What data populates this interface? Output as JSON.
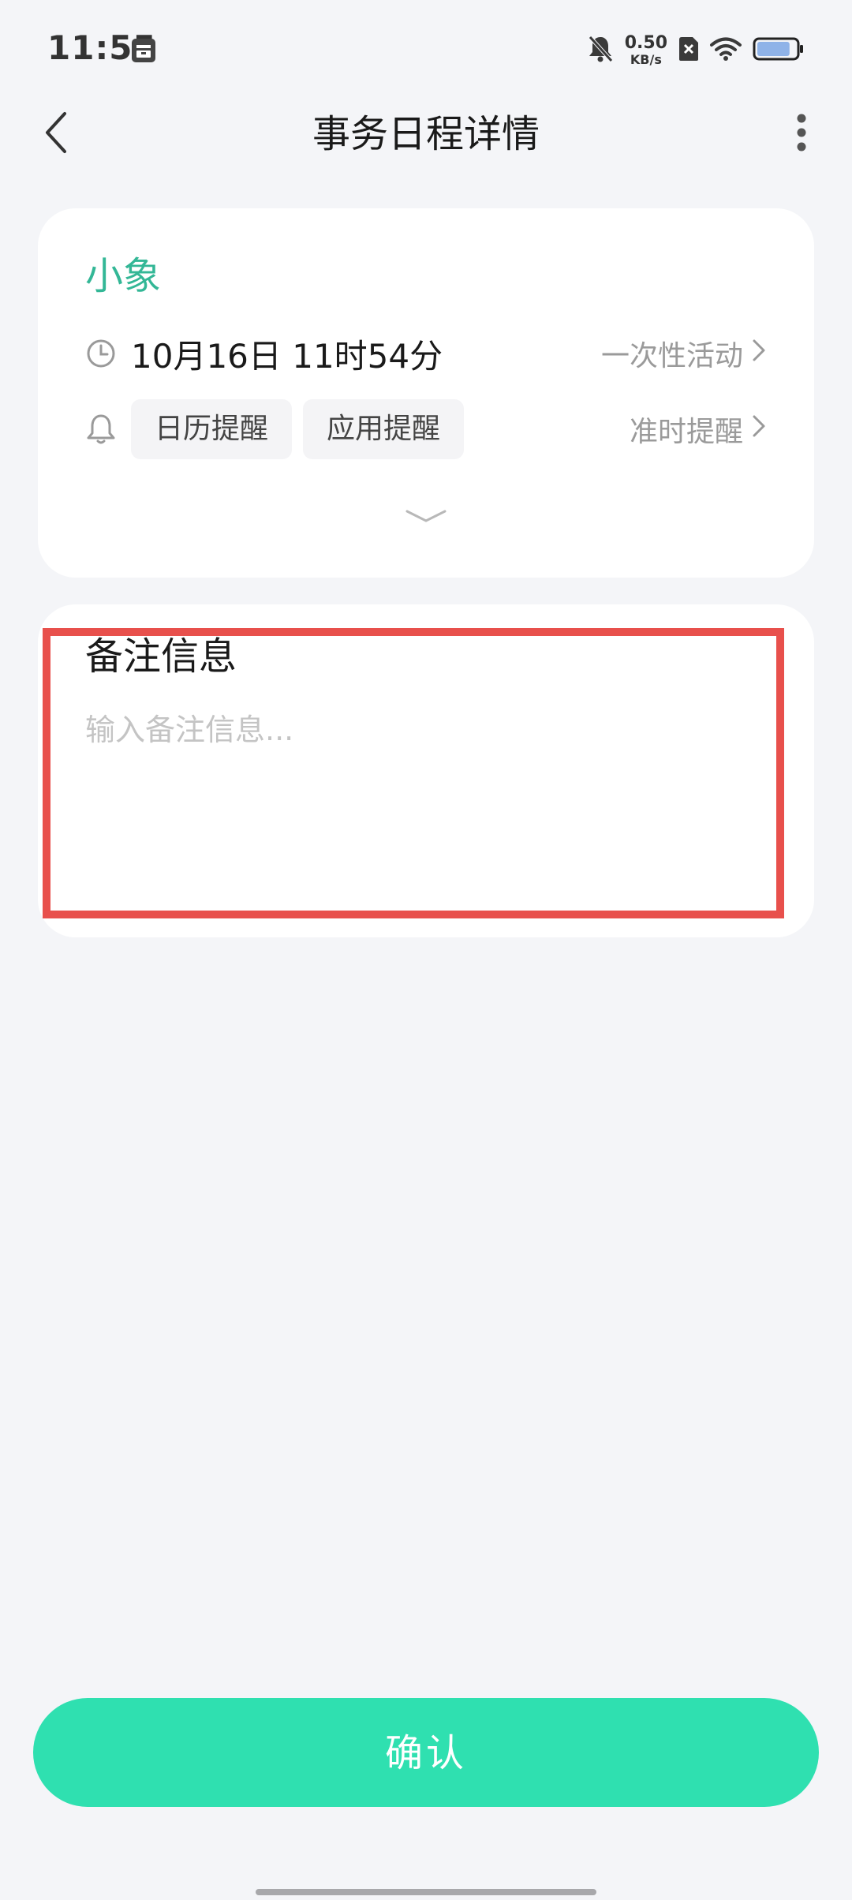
{
  "status_bar": {
    "time": "11:55",
    "net_speed_value": "0.50",
    "net_speed_unit": "KB/s",
    "battery_level": 0.85,
    "icons": [
      "calendar-app-icon",
      "mute-bell-icon",
      "sim-off-icon",
      "wifi-icon",
      "battery-icon"
    ]
  },
  "header": {
    "title": "事务日程详情",
    "back_icon": "chevron-left-icon",
    "more_icon": "more-vertical-icon"
  },
  "event": {
    "name": "小象",
    "datetime": "10月16日 11时54分",
    "repeat": "一次性活动",
    "reminder_chips": [
      "日历提醒",
      "应用提醒"
    ],
    "reminder_timing": "准时提醒"
  },
  "notes": {
    "title": "备注信息",
    "placeholder": "输入备注信息...",
    "value": ""
  },
  "confirm_label": "确认",
  "colors": {
    "accent_text": "#33b796",
    "confirm_bg": "#2fe0b0",
    "highlight_border": "#e8504c",
    "page_bg": "#f4f5f8"
  }
}
